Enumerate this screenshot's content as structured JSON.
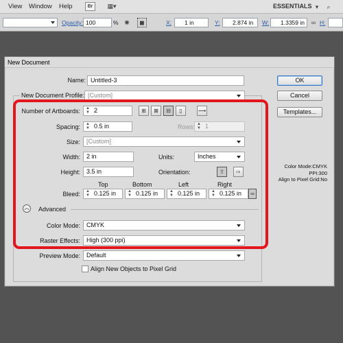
{
  "menubar": {
    "items": [
      "View",
      "Window",
      "Help"
    ],
    "bridge_label": "Br",
    "workspace": "ESSENTIALS"
  },
  "controlbar": {
    "opacity_label": "Opacity:",
    "opacity_value": "100",
    "opacity_unit": "%",
    "x_label": "X:",
    "x_value": "1 in",
    "y_label": "Y:",
    "y_value": "2.874 in",
    "w_label": "W:",
    "w_value": "1.3359 in",
    "h_label": "H:"
  },
  "dialog": {
    "title": "New Document",
    "name_label": "Name:",
    "name_value": "Untitled-3",
    "profile_label": "New Document Profile:",
    "profile_value": "[Custom]",
    "artboards_label": "Number of Artboards:",
    "artboards_value": "2",
    "spacing_label": "Spacing:",
    "spacing_value": "0.5 in",
    "rows_label": "Rows:",
    "rows_value": "1",
    "size_label": "Size:",
    "size_value": "[Custom]",
    "width_label": "Width:",
    "width_value": "2 in",
    "units_label": "Units:",
    "units_value": "Inches",
    "height_label": "Height:",
    "height_value": "3.5 in",
    "orientation_label": "Orientation:",
    "bleed_label": "Bleed:",
    "bleed_headers": [
      "Top",
      "Bottom",
      "Left",
      "Right"
    ],
    "bleed_values": [
      "0.125 in",
      "0.125 in",
      "0.125 in",
      "0.125 in"
    ],
    "advanced_label": "Advanced",
    "color_mode_label": "Color Mode:",
    "color_mode_value": "CMYK",
    "raster_label": "Raster Effects:",
    "raster_value": "High (300 ppi)",
    "preview_label": "Preview Mode:",
    "preview_value": "Default",
    "align_checkbox_label": "Align New Objects to Pixel Grid",
    "ok_label": "OK",
    "cancel_label": "Cancel",
    "templates_label": "Templates...",
    "info_color_mode": "Color Mode:CMYK",
    "info_ppi": "PPI:300",
    "info_align": "Align to Pixel Grid:No"
  },
  "colors": {
    "highlight": "#e3161d",
    "default_button_border": "#3b78c4",
    "link_blue": "#2a5cab"
  }
}
